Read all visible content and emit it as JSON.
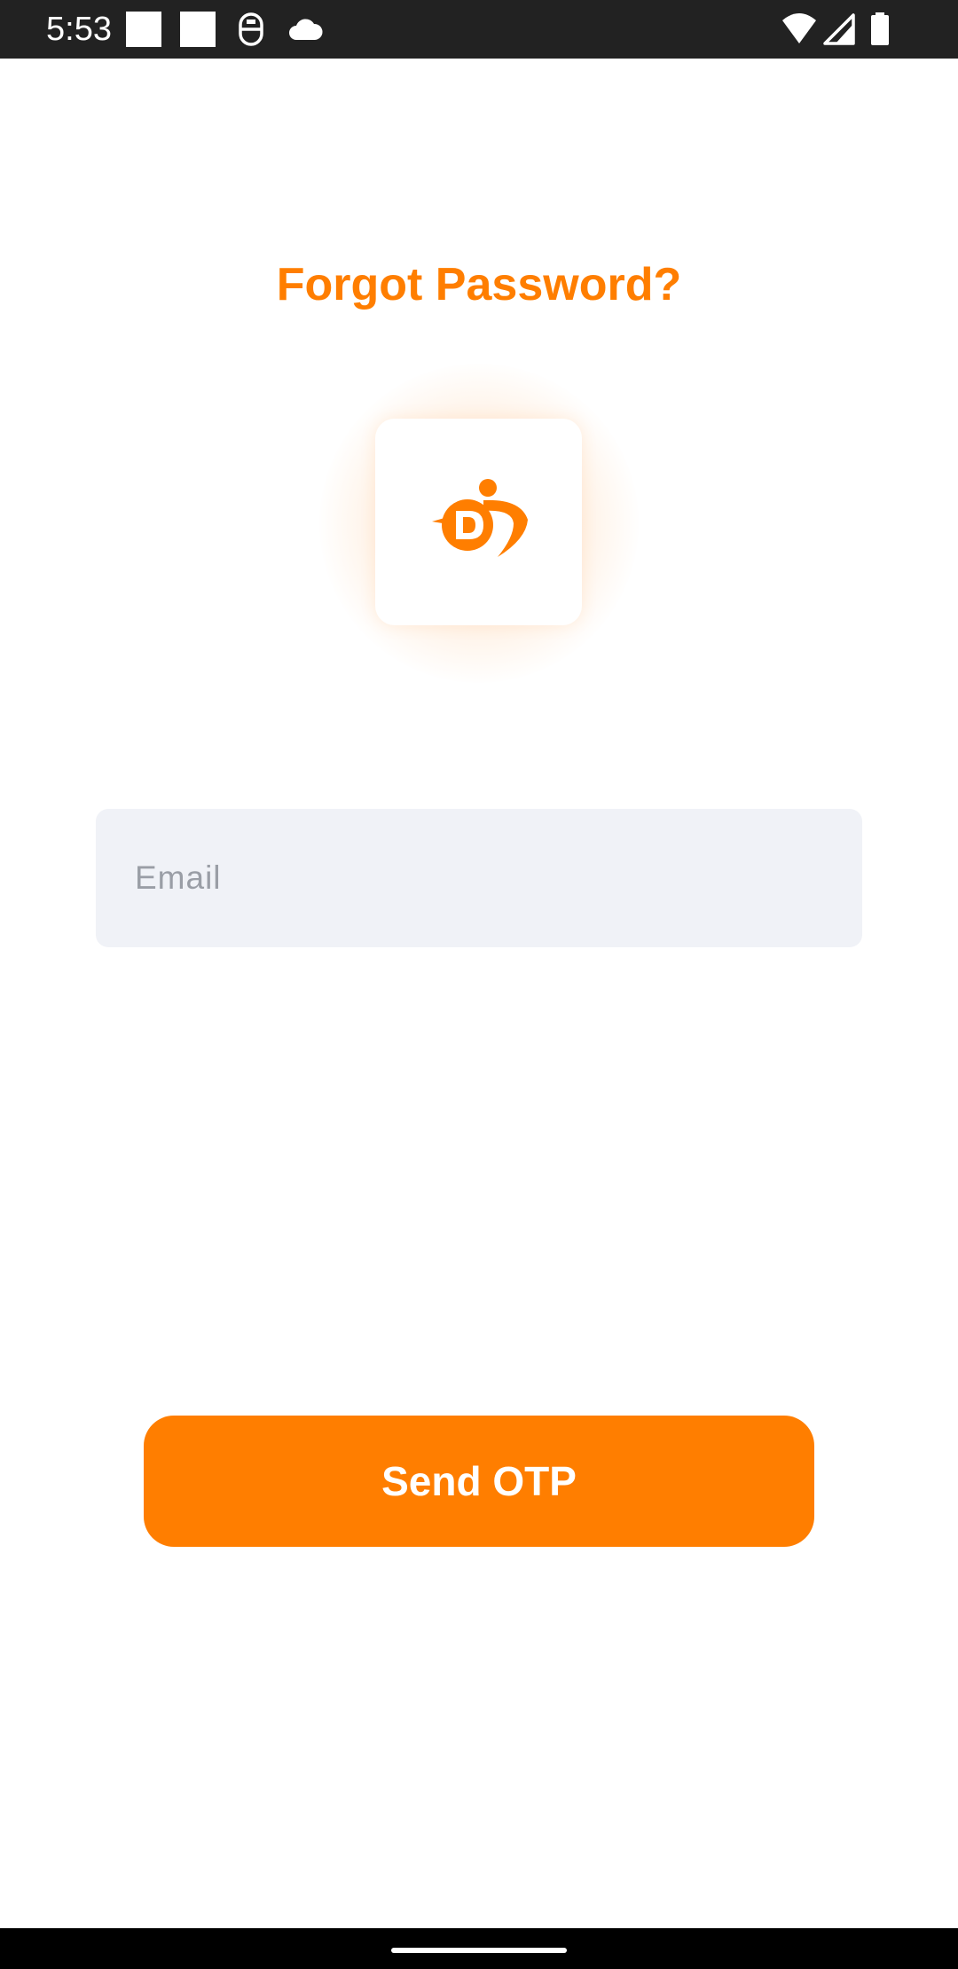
{
  "status_bar": {
    "time": "5:53",
    "icons": [
      "notification-square-icon",
      "notification-square-icon",
      "accessibility-icon",
      "cloud-icon",
      "wifi-icon",
      "signal-icon",
      "battery-icon"
    ]
  },
  "screen": {
    "title": "Forgot Password?",
    "logo": "app-logo-icon",
    "email": {
      "value": "",
      "placeholder": "Email"
    },
    "send_button_label": "Send OTP"
  },
  "colors": {
    "accent": "#FF7E00",
    "input_background": "#F0F2F7",
    "placeholder": "#9A9EA6",
    "status_bar": "#222222"
  }
}
